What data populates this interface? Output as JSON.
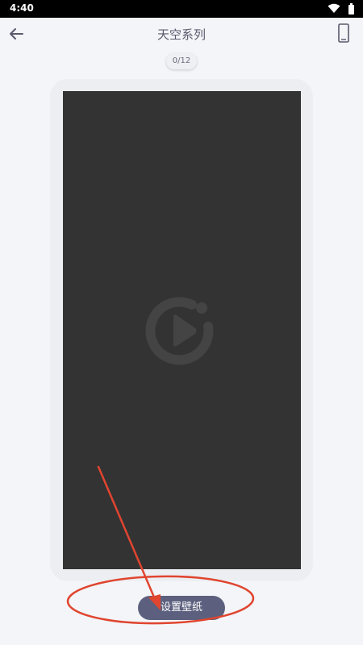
{
  "status_bar": {
    "time": "4:40",
    "icons": [
      "wifi-icon",
      "battery-icon"
    ]
  },
  "app_bar": {
    "title": "天空系列",
    "back_icon": "arrow-left-icon",
    "device_icon": "phone-outline-icon"
  },
  "preview": {
    "counter": "0/12",
    "placeholder_icon": "play-circle-logo-icon",
    "screen_color": "#333333"
  },
  "actions": {
    "set_wallpaper_label": "设置壁纸"
  },
  "annotation": {
    "color": "#e0452f",
    "shapes": [
      "arrow",
      "ellipse"
    ]
  },
  "colors": {
    "background": "#f3f5f8",
    "button": "#5c607e",
    "title": "#5a5a6e"
  }
}
